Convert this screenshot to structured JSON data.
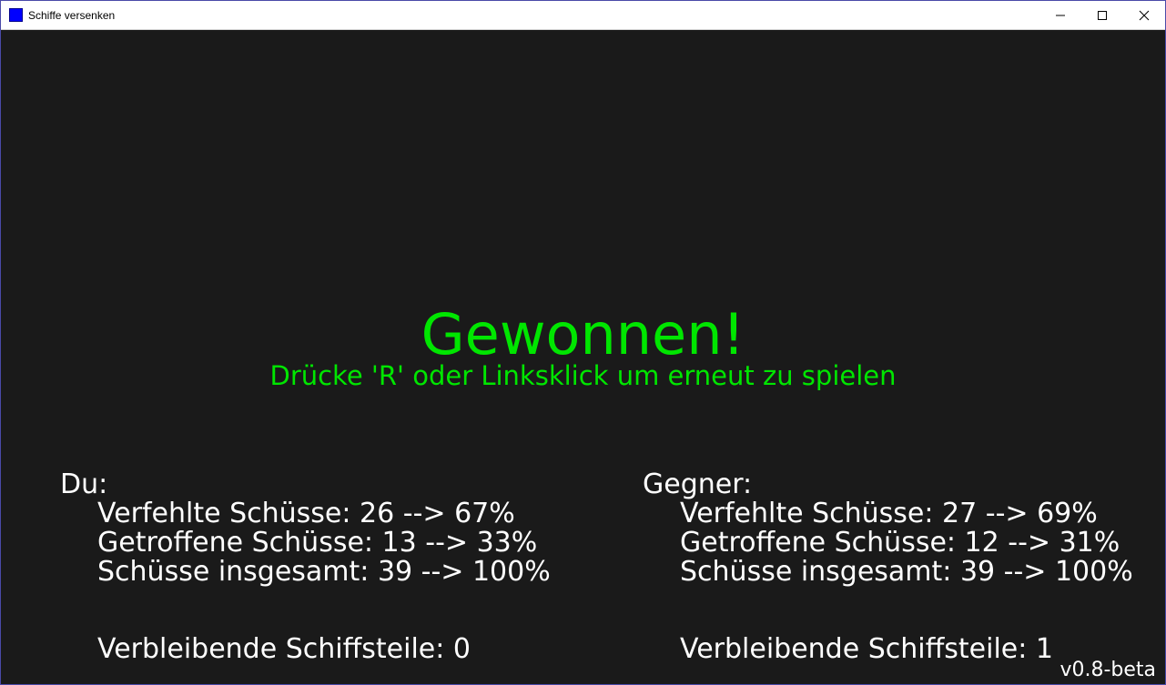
{
  "window": {
    "title": "Schiffe versenken",
    "icon": "app-icon-blue-square",
    "buttons": {
      "minimize": "minimize-icon",
      "maximize": "maximize-icon",
      "close": "close-icon"
    }
  },
  "game": {
    "result": "Gewonnen!",
    "restart_hint": "Drücke 'R' oder Linksklick um erneut zu spielen",
    "player": {
      "heading": "Du:",
      "missed": "Verfehlte Schüsse: 26 --> 67%",
      "hits": "Getroffene Schüsse: 13 --> 33%",
      "total": "Schüsse insgesamt: 39 --> 100%",
      "remaining": "Verbleibende Schiffsteile: 0"
    },
    "opponent": {
      "heading": "Gegner:",
      "missed": "Verfehlte Schüsse: 27 --> 69%",
      "hits": "Getroffene Schüsse: 12 --> 31%",
      "total": "Schüsse insgesamt: 39 --> 100%",
      "remaining": "Verbleibende Schiffsteile: 1"
    },
    "version": "v0.8-beta"
  },
  "colors": {
    "background": "#1a1a1a",
    "accent_green": "#00e600",
    "text": "#ffffff",
    "app_icon": "#0000ff"
  }
}
